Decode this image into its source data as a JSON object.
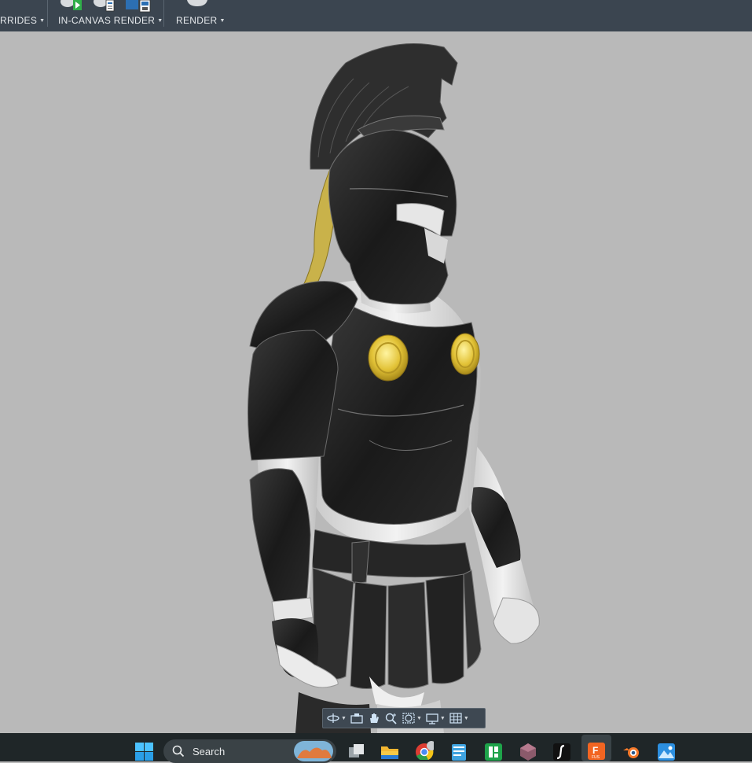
{
  "ribbon": {
    "groups": [
      {
        "label": "RRIDES",
        "icon": "overrides-icon"
      },
      {
        "label": "IN-CANVAS RENDER",
        "icon": "in-canvas-render-icon"
      },
      {
        "label": "RENDER",
        "icon": "render-icon"
      }
    ]
  },
  "viewport": {
    "background": "#b9b9b9",
    "model": "warrior-armor-model",
    "navbar": [
      "orbit-icon",
      "look-at-icon",
      "pan-icon",
      "zoom-icon",
      "fit-icon",
      "display-settings-icon",
      "grid-icon"
    ]
  },
  "taskbar": {
    "search_placeholder": "Search",
    "apps": [
      "windows-start-icon",
      "task-view-icon",
      "file-explorer-icon",
      "chrome-icon",
      "notepad-icon",
      "app-green-icon",
      "app-gem-icon",
      "app-script-icon",
      "fusion-icon",
      "blender-icon",
      "photos-icon"
    ],
    "colors": {
      "taskbar": "#1f2628",
      "ribbon": "#3b4550",
      "accent": "#f26522"
    }
  }
}
